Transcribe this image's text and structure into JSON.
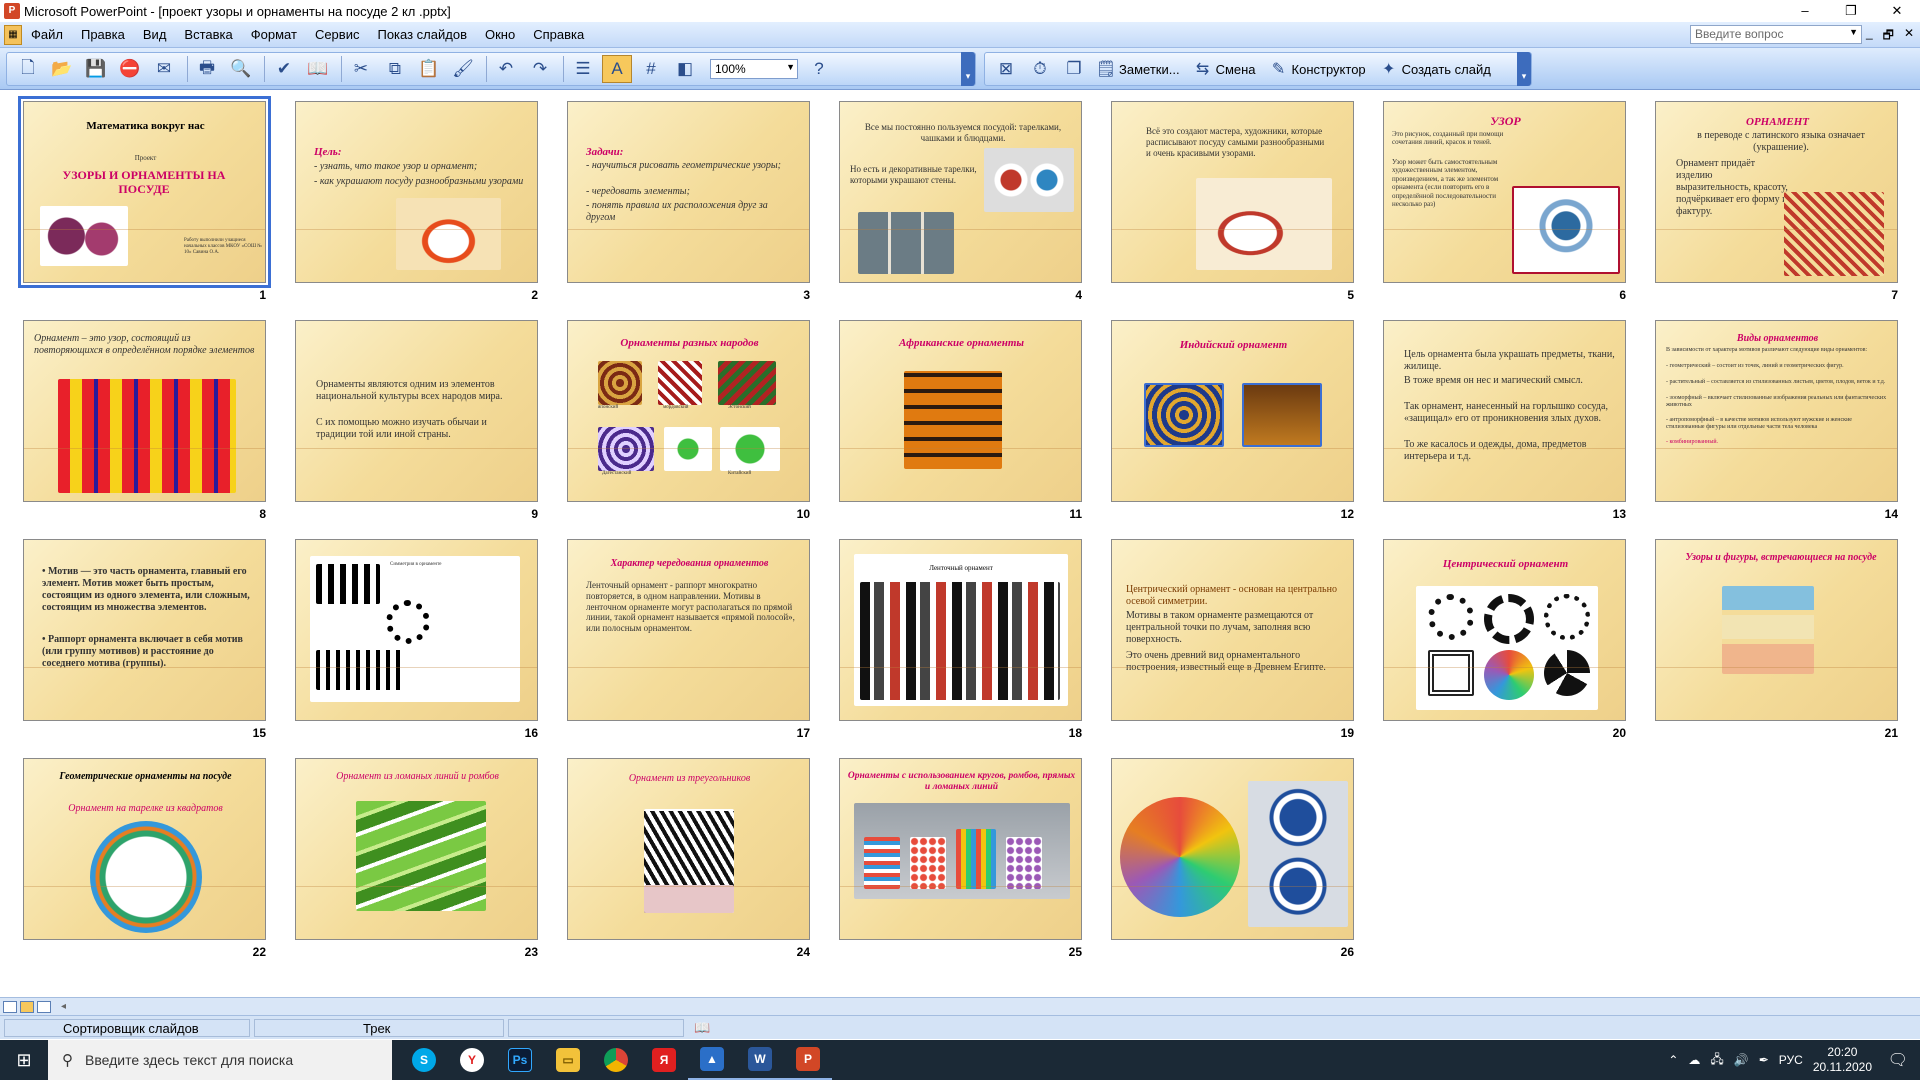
{
  "window": {
    "title": "Microsoft PowerPoint - [проект узоры и орнаменты на посуде 2 кл .pptx]",
    "minimize": "–",
    "maximize": "❐",
    "close": "✕"
  },
  "menu": {
    "items": [
      "Файл",
      "Правка",
      "Вид",
      "Вставка",
      "Формат",
      "Сервис",
      "Показ слайдов",
      "Окно",
      "Справка"
    ],
    "help_placeholder": "Введите вопрос",
    "doc_controls": [
      "_",
      "🗗",
      "✕"
    ]
  },
  "toolbar": {
    "zoom": "100%",
    "notes_label": "Заметки...",
    "transition_label": "Смена",
    "designer_label": "Конструктор",
    "new_slide_label": "Создать слайд"
  },
  "slides": [
    {
      "n": "1",
      "title": "Математика вокруг нас",
      "sub": "Проект",
      "head": "УЗОРЫ И ОРНАМЕНТЫ НА ПОСУДЕ",
      "author": "Работу выполнили учащиеся начальных классов МКОУ «СОШ № 10» Савина О.А."
    },
    {
      "n": "2",
      "title": "Цель:",
      "lines": [
        "- узнать, что такое узор и орнамент;",
        "- как украшают посуду разнообразными узорами"
      ]
    },
    {
      "n": "3",
      "title": "Задачи:",
      "lines": [
        "- научиться рисовать геометрические узоры;",
        "- чередовать элементы;",
        "- понять правила их расположения друг за другом"
      ]
    },
    {
      "n": "4",
      "lines": [
        "Все мы постоянно пользуемся посудой: тарелками, чашками и блюдцами.",
        "Но есть и декоративные тарелки, которыми украшают стены."
      ]
    },
    {
      "n": "5",
      "lines": [
        "Всё это создают мастера, художники, которые расписывают посуду самыми разнообразными и очень красивыми узорами."
      ]
    },
    {
      "n": "6",
      "title": "УЗОР",
      "lines": [
        "Это рисунок, созданный при помощи сочетания линий, красок и теней.",
        "Узор может быть самостоятельным художественным элементом, произведением, а так же элементом орнамента (если повторить его в определённой последовательности несколько раз)"
      ]
    },
    {
      "n": "7",
      "title": "ОРНАМЕНТ",
      "lines": [
        "в переводе с латинского языка означает (украшение).",
        "Орнамент придаёт изделию выразительность, красоту, подчёркивает его форму и фактуру."
      ]
    },
    {
      "n": "8",
      "lines": [
        "Орнамент – это узор, состоящий из повторяющихся в определённом порядке элементов"
      ]
    },
    {
      "n": "9",
      "lines": [
        "Орнаменты являются одним из элементов национальной культуры всех народов мира.",
        "С их помощью можно изучать обычаи и традиции той или иной страны."
      ]
    },
    {
      "n": "10",
      "title": "Орнаменты разных народов",
      "caps": [
        "японский",
        "мордовский",
        "Эстонский",
        "Дагестанский",
        "Китайский"
      ]
    },
    {
      "n": "11",
      "title": "Африканские орнаменты"
    },
    {
      "n": "12",
      "title": "Индийский орнамент"
    },
    {
      "n": "13",
      "lines": [
        "Цель орнамента была украшать предметы, ткани, жилище.",
        "В тоже время он нес и магический смысл.",
        "Так орнамент, нанесенный на горлышко сосуда, «защищал» его от проникновения злых духов.",
        "То же касалось и одежды, дома, предметов интерьера и т.д."
      ]
    },
    {
      "n": "14",
      "title": "Виды орнаментов",
      "lines": [
        "В зависимости от характера мотивов различают следующие виды орнаментов:",
        "- геометрический – состоит из точек, линий и геометрических фигур.",
        "- растительный – составляется из стилизованных листьев, цветов, плодов, веток и т.д.",
        "- зооморфный – включает стилизованные изображения реальных или фантастических животных",
        "- антропоморфный – в качестве мотивов используют мужские и женские стилизованные фигуры или отдельные части тела человека",
        "- комбинированный."
      ]
    },
    {
      "n": "15",
      "lines": [
        "• Мотив — это часть орнамента, главный его элемент. Мотив может быть простым, состоящим из одного элемента, или сложным, состоящим из множества элементов.",
        "• Раппорт орнамента включает в себя мотив (или группу мотивов) и расстояние до соседнего мотива (группы)."
      ]
    },
    {
      "n": "16",
      "lines": [
        "Симметрия в орнаменте"
      ]
    },
    {
      "n": "17",
      "title": "Характер чередования орнаментов",
      "lines": [
        "Ленточный орнамент - раппорт многократно повторяется, в одном направлении. Мотивы в ленточном орнаменте могут располагаться по прямой линии, такой орнамент называется «прямой полосой», или полосным орнаментом."
      ]
    },
    {
      "n": "18",
      "lines": [
        "Ленточный орнамент"
      ]
    },
    {
      "n": "19",
      "lines": [
        "Центрический орнамент - основан на центрально осевой симметрии.",
        "Мотивы в таком орнаменте размещаются от центральной точки по лучам, заполняя всю поверхность.",
        "Это очень древний вид орнаментального построения, известный еще в Древнем Египте."
      ]
    },
    {
      "n": "20",
      "title": "Центрический орнамент"
    },
    {
      "n": "21",
      "title": "Узоры и фигуры, встречающиеся на посуде"
    },
    {
      "n": "22",
      "title": "Геометрические орнаменты на посуде",
      "lines": [
        "Орнамент на тарелке из квадратов"
      ]
    },
    {
      "n": "23",
      "title": "Орнамент из ломаных линий и ромбов"
    },
    {
      "n": "24",
      "title": "Орнамент из треугольников"
    },
    {
      "n": "25",
      "title": "Орнаменты с использованием кругов, ромбов, прямых и ломаных линий"
    },
    {
      "n": "26"
    }
  ],
  "statusbar": {
    "view": "Сортировщик слайдов",
    "design": "Трек"
  },
  "taskbar": {
    "search_placeholder": "Введите здесь текст для поиска",
    "lang": "РУС",
    "time": "20:20",
    "date": "20.11.2020"
  },
  "colors": {
    "slide_bg": "#f4dc9a",
    "accent_red": "#cc0066",
    "selection": "#3b6fd4"
  }
}
